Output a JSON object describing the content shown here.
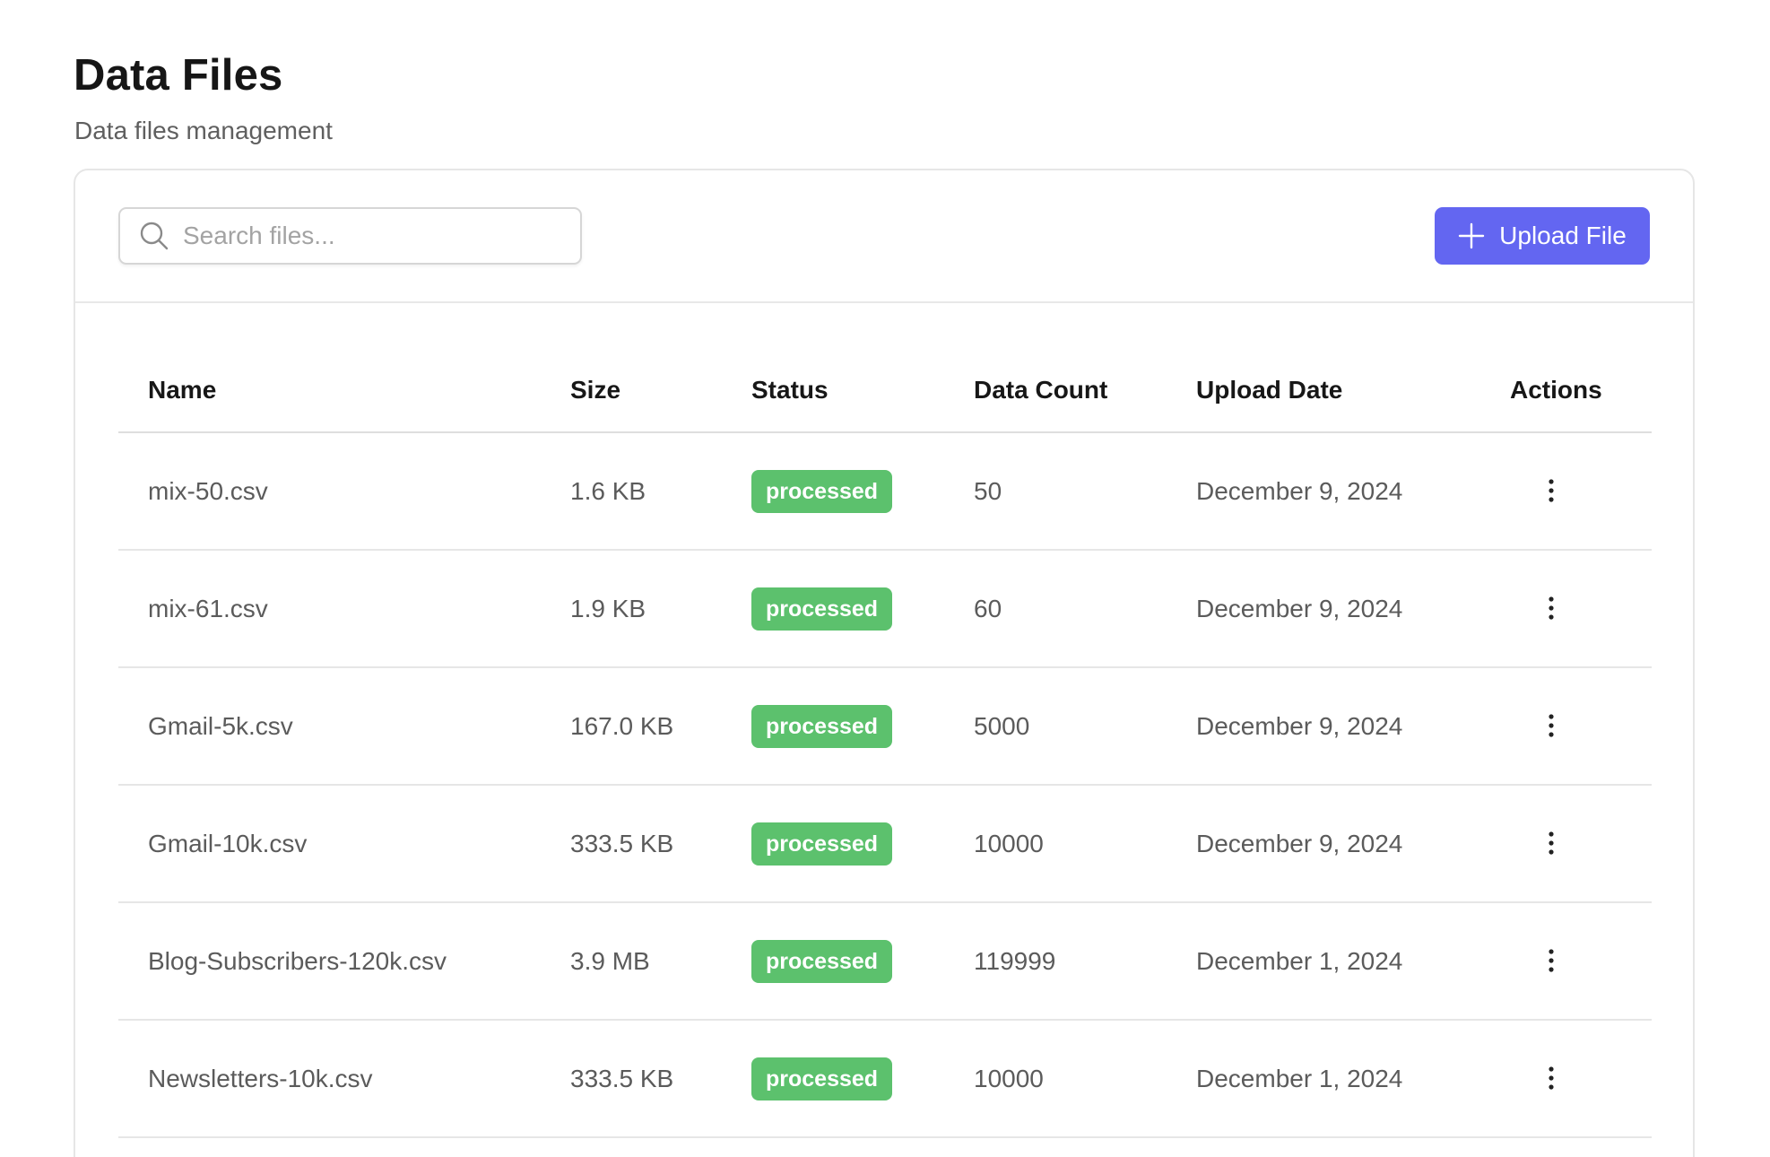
{
  "header": {
    "title": "Data Files",
    "subtitle": "Data files management"
  },
  "toolbar": {
    "search_placeholder": "Search files...",
    "search_value": "",
    "upload_label": "Upload File",
    "upload_color": "#6366f1"
  },
  "table": {
    "columns": [
      "Name",
      "Size",
      "Status",
      "Data Count",
      "Upload Date",
      "Actions"
    ],
    "rows": [
      {
        "name": "mix-50.csv",
        "size": "1.6 KB",
        "status": "processed",
        "count": "50",
        "date": "December 9, 2024"
      },
      {
        "name": "mix-61.csv",
        "size": "1.9 KB",
        "status": "processed",
        "count": "60",
        "date": "December 9, 2024"
      },
      {
        "name": "Gmail-5k.csv",
        "size": "167.0 KB",
        "status": "processed",
        "count": "5000",
        "date": "December 9, 2024"
      },
      {
        "name": "Gmail-10k.csv",
        "size": "333.5 KB",
        "status": "processed",
        "count": "10000",
        "date": "December 9, 2024"
      },
      {
        "name": "Blog-Subscribers-120k.csv",
        "size": "3.9 MB",
        "status": "processed",
        "count": "119999",
        "date": "December 1, 2024"
      },
      {
        "name": "Newsletters-10k.csv",
        "size": "333.5 KB",
        "status": "processed",
        "count": "10000",
        "date": "December 1, 2024"
      }
    ],
    "status_color": "#5cc16d",
    "actions_icon": "more-vertical-icon"
  }
}
